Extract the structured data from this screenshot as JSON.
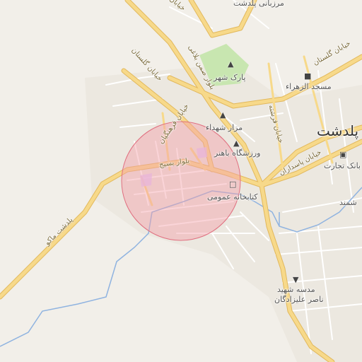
{
  "map": {
    "city_label": "پلدشت",
    "labels": {
      "marzbani": "مرزبانی پلدشت",
      "park": "پارک شهر",
      "mosque": "مسجد الزهراء",
      "shohada": "مزار شهداء",
      "varzeshgah": "ورزشگاه باهنر",
      "ketabkhaneh": "کتابخانه عمومی",
      "bank": "بانک تجارت",
      "school_line1": "مدسه  شهید",
      "school_line2": "ناصر علیزادگان",
      "shmand": "شمند"
    },
    "roads": {
      "golestan_w": "خیابان گلستان",
      "golestan_e": "خیابان گلستان",
      "basij": "بلوار بسیج",
      "samen": "بلوار صمن بلاغی",
      "pasdaran": "خیابان پاسداران",
      "ferdowsi": "خیابان فرشته",
      "farhangian": "خیابان فرهنگیان",
      "poldasht_maku": "پلدشت ماکو",
      "road_top": "خیابان"
    },
    "icons": {
      "park": "tree-icon",
      "mosque": "mosque-icon",
      "shohada": "monument-icon",
      "varzeshgah": "stadium-icon",
      "library": "book-icon",
      "bank": "bank-icon",
      "school": "graduation-cap-icon"
    },
    "colors": {
      "background": "#f2efe9",
      "major_road": "#f7d98a",
      "major_road_casing": "#e2b85c",
      "minor_road": "#ffffff",
      "water": "#8fb3e0",
      "park": "#c8e6b0",
      "highlight_circle_fill": "#f4a0a8",
      "highlight_circle_stroke": "#e07080"
    }
  }
}
